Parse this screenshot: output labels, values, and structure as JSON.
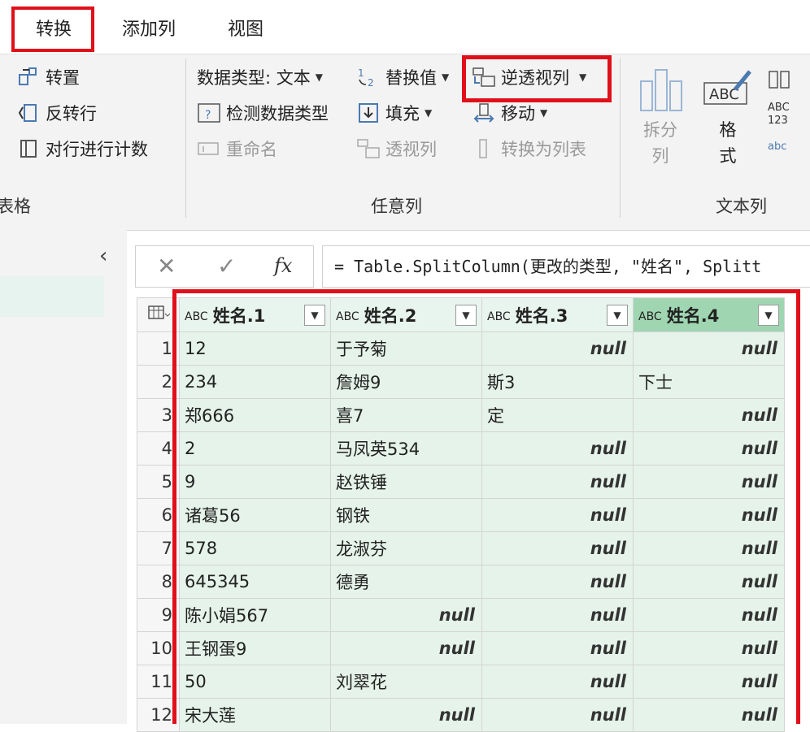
{
  "tabs": [
    {
      "label": "转换"
    },
    {
      "label": "添加列"
    },
    {
      "label": "视图"
    }
  ],
  "ribbon": {
    "table_group": {
      "transpose": "转置",
      "reverse_rows": "反转行",
      "count_rows": "对行进行计数",
      "label": "表格"
    },
    "any_column_group": {
      "data_type": "数据类型: 文本",
      "replace_values": "替换值",
      "unpivot_columns": "逆透视列",
      "detect_type": "检测数据类型",
      "fill": "填充",
      "move": "移动",
      "rename": "重命名",
      "pivot_column": "透视列",
      "convert_to_list": "转换为列表",
      "label": "任意列"
    },
    "text_column_group": {
      "split_column": "拆分列",
      "format": "格式",
      "label": "文本列",
      "abc_label": "ABC",
      "abc123_label": "ABC 123"
    }
  },
  "formula": {
    "cancel": "✕",
    "confirm": "✓",
    "fx": "fx",
    "text": "= Table.SplitColumn(更改的类型, \"姓名\", Splitt"
  },
  "table": {
    "columns": [
      "姓名.1",
      "姓名.2",
      "姓名.3",
      "姓名.4"
    ],
    "type_label": "ABC",
    "rows": [
      {
        "n": "1",
        "c": [
          "12",
          "于予菊",
          "null",
          "null"
        ]
      },
      {
        "n": "2",
        "c": [
          "234",
          "詹姆9",
          "斯3",
          "下士"
        ]
      },
      {
        "n": "3",
        "c": [
          "郑666",
          "喜7",
          "定",
          "null"
        ]
      },
      {
        "n": "4",
        "c": [
          "2",
          "马凤英534",
          "null",
          "null"
        ]
      },
      {
        "n": "5",
        "c": [
          "9",
          "赵铁锤",
          "null",
          "null"
        ]
      },
      {
        "n": "6",
        "c": [
          "诸葛56",
          "钢铁",
          "null",
          "null"
        ]
      },
      {
        "n": "7",
        "c": [
          "578",
          "龙淑芬",
          "null",
          "null"
        ]
      },
      {
        "n": "8",
        "c": [
          "645345",
          "德勇",
          "null",
          "null"
        ]
      },
      {
        "n": "9",
        "c": [
          "陈小娟567",
          "null",
          "null",
          "null"
        ]
      },
      {
        "n": "10",
        "c": [
          "王钢蛋9",
          "null",
          "null",
          "null"
        ]
      },
      {
        "n": "11",
        "c": [
          "50",
          "刘翠花",
          "null",
          "null"
        ]
      },
      {
        "n": "12",
        "c": [
          "宋大莲",
          "null",
          "null",
          "null"
        ]
      }
    ]
  },
  "colors": {
    "highlight_red": "#e0101a",
    "cell_green": "#e5f3ea",
    "selected_header_green": "#9fd6b1"
  }
}
